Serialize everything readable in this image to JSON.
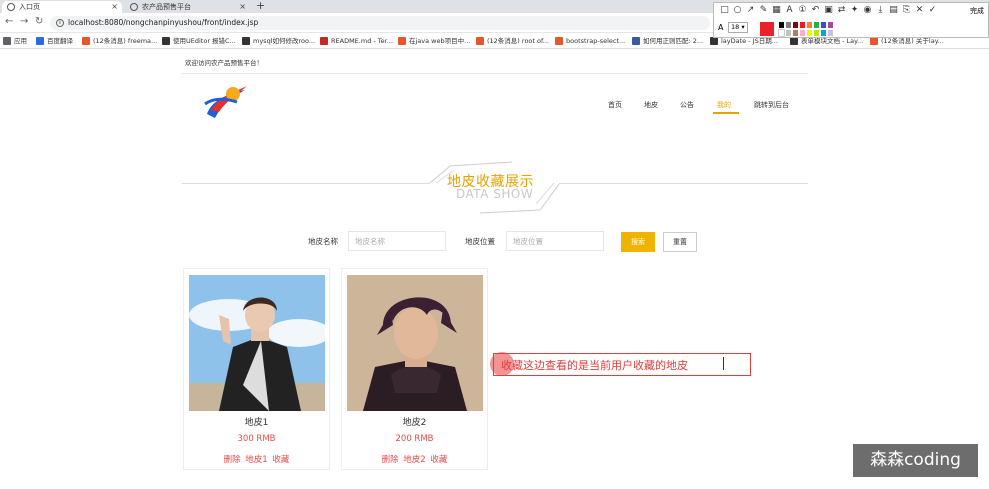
{
  "browser": {
    "tabs": [
      {
        "title": "入口页",
        "close": "×"
      },
      {
        "title": "农产品预售平台",
        "close": "×"
      }
    ],
    "new_tab": "+",
    "url": "localhost:8080/nongchanpinyushou/front/index.jsp",
    "bookmarks": [
      {
        "label": "应用",
        "color": "#5f6368"
      },
      {
        "label": "百度翻译",
        "color": "#2b6de0"
      },
      {
        "label": "(12条消息) freema...",
        "color": "#e8562a"
      },
      {
        "label": "使用UEditor 报错C...",
        "color": "#333"
      },
      {
        "label": "mysql如何修改roo...",
        "color": "#333"
      },
      {
        "label": "README.md - Ter...",
        "color": "#c62828"
      },
      {
        "label": "在java web项目中...",
        "color": "#e8562a"
      },
      {
        "label": "(12条消息) root of...",
        "color": "#e8562a"
      },
      {
        "label": "bootstrap-select...",
        "color": "#e8562a"
      },
      {
        "label": "如何用正则匹配: 2...",
        "color": "#3a5ba0"
      },
      {
        "label": "layDate - JS日期...",
        "color": "#333"
      },
      {
        "label": "表单模块文档 - Lay...",
        "color": "#333"
      },
      {
        "label": "(12条消息) 关于lay...",
        "color": "#e8562a"
      }
    ]
  },
  "snap_tool": {
    "done_label": "完成",
    "font_size": "18"
  },
  "site": {
    "welcome": "欢迎访问农产品预售平台！",
    "nav": [
      "首页",
      "地皮",
      "公告",
      "我的",
      "跳转到后台"
    ],
    "active_nav": "我的",
    "section_title": "地皮收藏展示",
    "section_subtitle": "DATA SHOW",
    "search": {
      "name_label": "地皮名称",
      "name_placeholder": "地皮名称",
      "position_label": "地皮位置",
      "position_placeholder": "地皮位置",
      "search_button": "搜索",
      "reset_button": "重置"
    },
    "cards": [
      {
        "name": "地皮1",
        "price": "300 RMB",
        "delete": "删除",
        "fav_name": "地皮1",
        "fav": "收藏"
      },
      {
        "name": "地皮2",
        "price": "200 RMB",
        "delete": "删除",
        "fav_name": "地皮2",
        "fav": "收藏"
      }
    ]
  },
  "annotation": "收藏这边查看的是当前用户收藏的地皮",
  "watermark": "森森coding",
  "colors": {
    "accent": "#e8a200",
    "price_red": "#e84a4a",
    "annot_red": "#e23c3c"
  }
}
